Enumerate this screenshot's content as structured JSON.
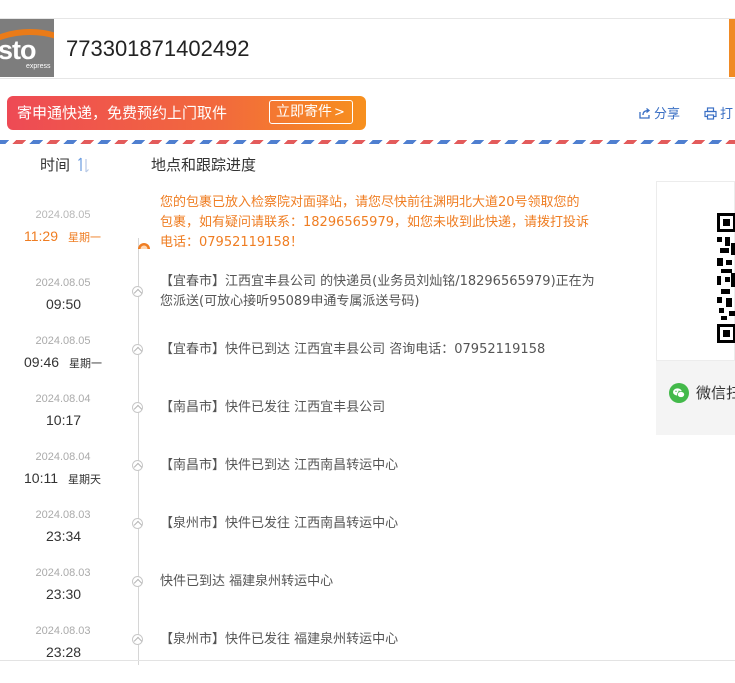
{
  "header": {
    "logo_text": "sto",
    "logo_sub": "express",
    "tracking_number": "773301871402492"
  },
  "promo": {
    "text": "寄申通快递，免费预约上门取件",
    "button_label": "立即寄件",
    "button_arrow": ">"
  },
  "actions": {
    "share_label": "分享",
    "print_label": "打"
  },
  "table": {
    "col_time": "时间",
    "col_place": "地点和跟踪进度"
  },
  "events": [
    {
      "date": "2024.08.05",
      "time": "11:29",
      "weekday": "星期一",
      "text": "您的包裹已放入检察院对面驿站，请您尽快前往渊明北大道20号领取您的包裹，如有疑问请联系：18296565979，如您未收到此快递，请拨打投诉电话：07952119158！"
    },
    {
      "date": "2024.08.05",
      "time": "09:50",
      "weekday": "",
      "text": "【宜春市】江西宜丰县公司 的快递员(业务员刘灿铭/18296565979)正在为您派送(可放心接听95089申通专属派送号码)"
    },
    {
      "date": "2024.08.05",
      "time": "09:46",
      "weekday": "星期一",
      "text": "【宜春市】快件已到达 江西宜丰县公司 咨询电话：07952119158"
    },
    {
      "date": "2024.08.04",
      "time": "10:17",
      "weekday": "",
      "text": "【南昌市】快件已发往 江西宜丰县公司"
    },
    {
      "date": "2024.08.04",
      "time": "10:11",
      "weekday": "星期天",
      "text": "【南昌市】快件已到达 江西南昌转运中心"
    },
    {
      "date": "2024.08.03",
      "time": "23:34",
      "weekday": "",
      "text": "【泉州市】快件已发往 江西南昌转运中心"
    },
    {
      "date": "2024.08.03",
      "time": "23:30",
      "weekday": "",
      "text": "快件已到达 福建泉州转运中心"
    },
    {
      "date": "2024.08.03",
      "time": "23:28",
      "weekday": "",
      "text": "【泉州市】快件已发往 福建泉州转运中心"
    }
  ],
  "qr_panel": {
    "wechat_label": "微信扫"
  },
  "colors": {
    "brand_orange": "#ef7d22",
    "link_blue": "#3a6fc4",
    "wechat_green": "#43b94a"
  },
  "icons": {
    "share": "share-icon",
    "print": "print-icon",
    "sort": "sort-icon",
    "wechat": "wechat-icon"
  }
}
